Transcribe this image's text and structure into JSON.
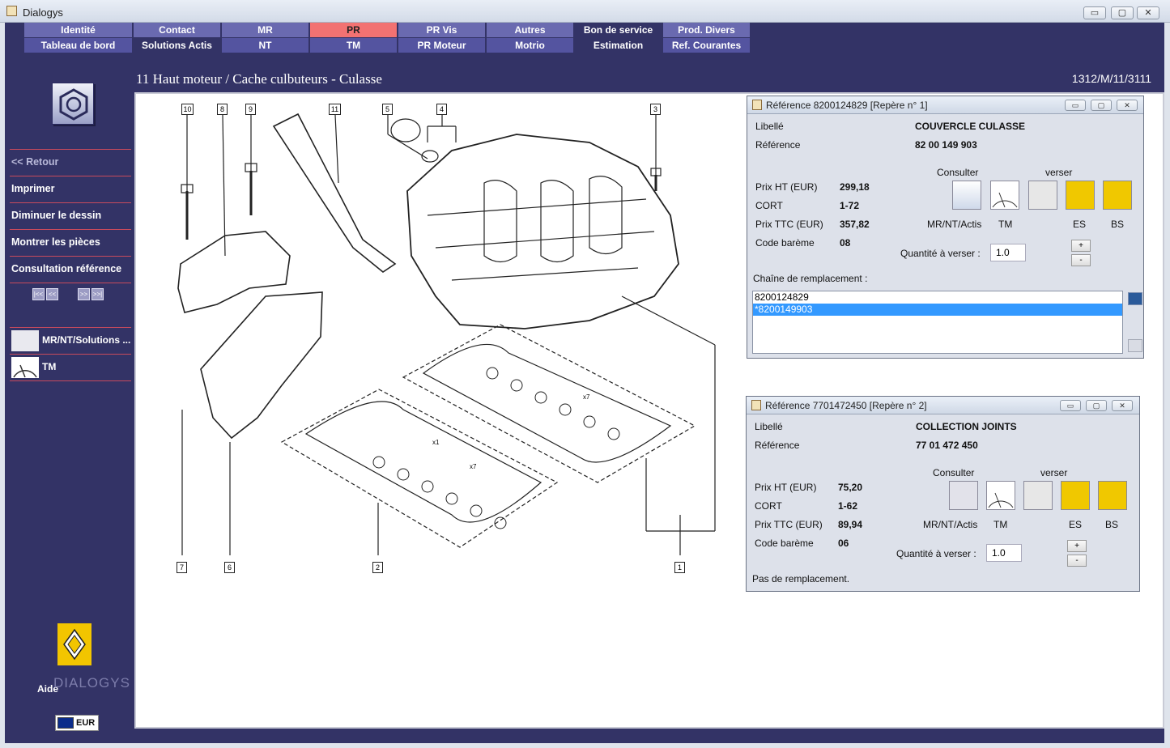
{
  "window": {
    "title": "Dialogys",
    "btn_min": "▭",
    "btn_max": "▢",
    "btn_close": "✕"
  },
  "nav": {
    "row1": [
      "Identité",
      "Contact",
      "MR",
      "PR",
      "PR Vis",
      "Autres",
      "Bon de service",
      "Prod. Divers"
    ],
    "row2": [
      "Tableau de bord",
      "Solutions Actis",
      "NT",
      "TM",
      "PR Moteur",
      "Motrio",
      "Estimation",
      "Ref. Courantes"
    ]
  },
  "sidebar": {
    "retour": "<< Retour",
    "imprimer": "Imprimer",
    "diminuer": "Diminuer le dessin",
    "montrer": "Montrer les pièces",
    "consultation": "Consultation référence",
    "pager": [
      "|<<",
      "<<",
      ">>",
      ">>|"
    ],
    "mr_btn": "MR/NT/Solutions ...",
    "tm_btn": "TM",
    "aide": "Aide",
    "brand": "DIALOGYS",
    "currency": "EUR"
  },
  "page": {
    "title": "11 Haut moteur / Cache culbuteurs - Culasse",
    "code": "1312/M/11/3111"
  },
  "diagram": {
    "callouts": [
      "10",
      "8",
      "9",
      "11",
      "5",
      "4",
      "3",
      "7",
      "6",
      "2",
      "1"
    ],
    "annotations": [
      "x7",
      "x1",
      "x7"
    ]
  },
  "panel1": {
    "title": "Référence 8200124829 [Repère n° 1]",
    "libelle_label": "Libellé",
    "libelle": "COUVERCLE CULASSE",
    "ref_label": "Référence",
    "ref": "82 00 149 903",
    "consulter": "Consulter",
    "verser": "verser",
    "prix_ht_label": "Prix HT (EUR)",
    "prix_ht": "299,18",
    "cort_label": "CORT",
    "cort": "1-72",
    "prix_ttc_label": "Prix TTC (EUR)",
    "prix_ttc": "357,82",
    "code_label": "Code barème",
    "code": "08",
    "icons": [
      "MR/NT/Actis",
      "TM",
      "ES",
      "BS"
    ],
    "qty_label": "Quantité à verser :",
    "qty": "1.0",
    "plus": "+",
    "minus": "-",
    "chain_label": "Chaîne de remplacement :",
    "chain": [
      "8200124829",
      "*8200149903"
    ]
  },
  "panel2": {
    "title": "Référence 7701472450 [Repère n° 2]",
    "libelle_label": "Libellé",
    "libelle": "COLLECTION JOINTS",
    "ref_label": "Référence",
    "ref": "77 01 472 450",
    "consulter": "Consulter",
    "verser": "verser",
    "prix_ht_label": "Prix HT (EUR)",
    "prix_ht": "75,20",
    "cort_label": "CORT",
    "cort": "1-62",
    "prix_ttc_label": "Prix TTC (EUR)",
    "prix_ttc": "89,94",
    "code_label": "Code barème",
    "code": "06",
    "icons": [
      "MR/NT/Actis",
      "TM",
      "ES",
      "BS"
    ],
    "qty_label": "Quantité à verser :",
    "qty": "1.0",
    "plus": "+",
    "minus": "-",
    "no_repl": "Pas de remplacement."
  }
}
